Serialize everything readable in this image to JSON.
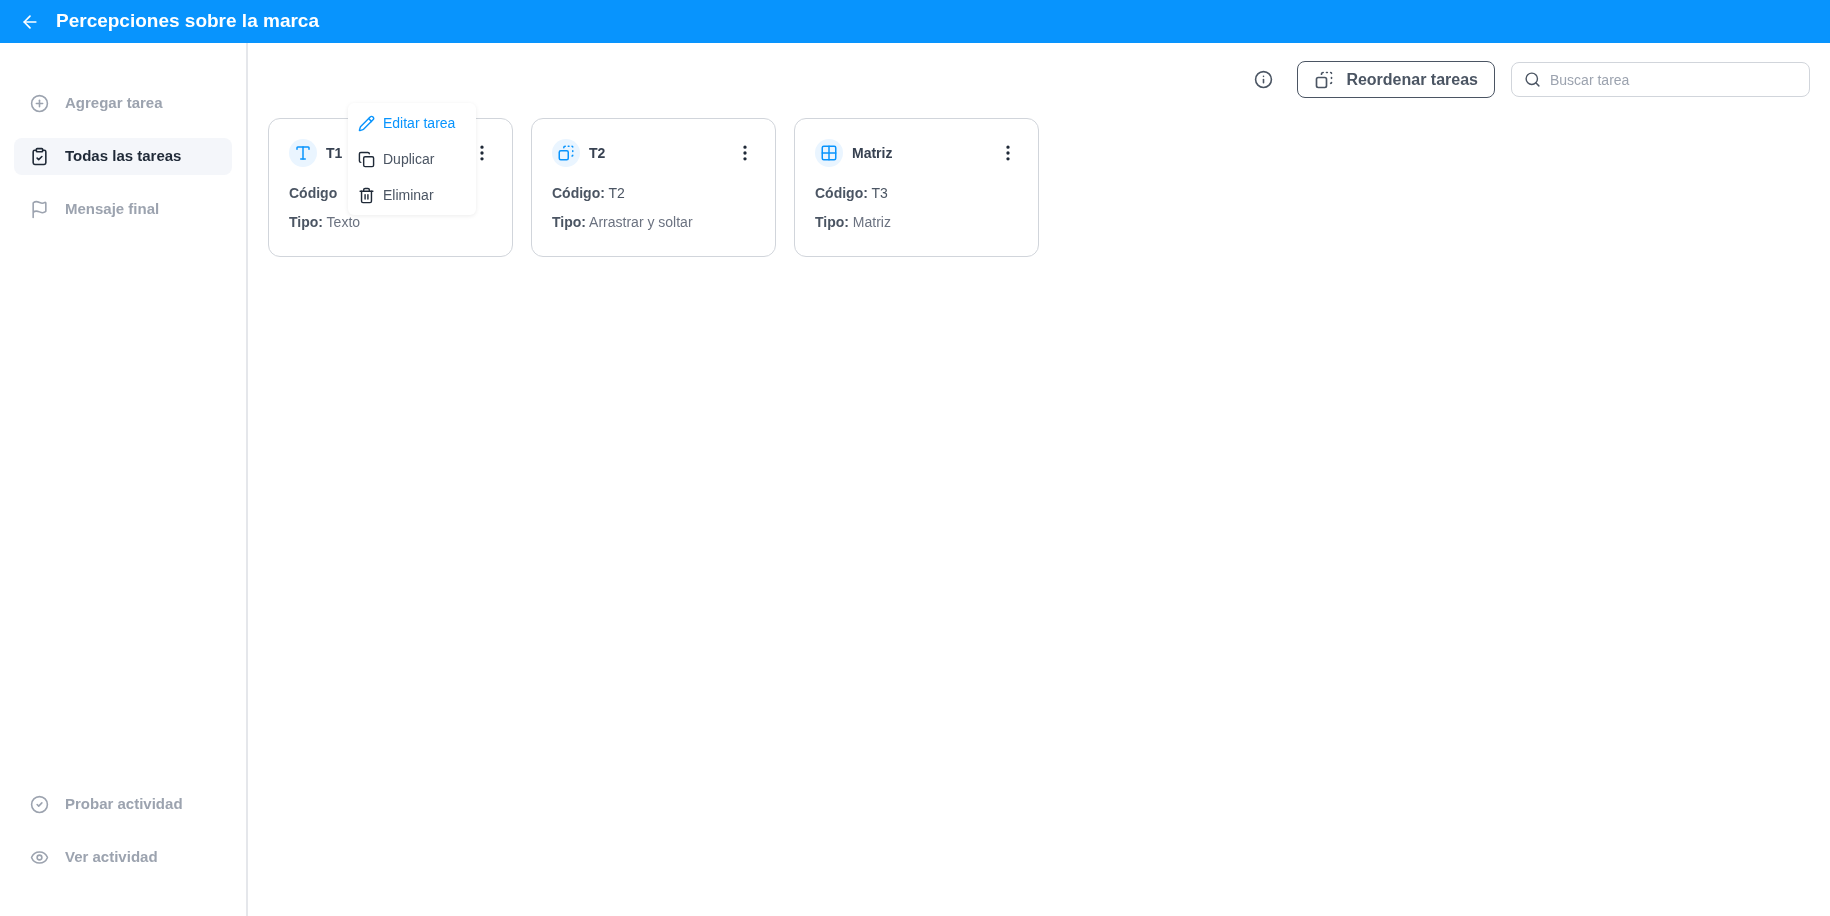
{
  "header": {
    "title": "Percepciones sobre la marca"
  },
  "sidebar": {
    "items": [
      {
        "kind": "add",
        "label": "Agregar tarea",
        "selected": false
      },
      {
        "kind": "tasks",
        "label": "Todas las tareas",
        "selected": true
      },
      {
        "kind": "flag",
        "label": "Mensaje final",
        "selected": false
      }
    ],
    "bottom_items": [
      {
        "kind": "check",
        "label": "Probar actividad"
      },
      {
        "kind": "eye",
        "label": "Ver actividad"
      }
    ]
  },
  "toolbar": {
    "reorder_button": "Reordenar tareas",
    "search": {
      "placeholder": "Buscar tarea"
    }
  },
  "cards": [
    {
      "kind": "text",
      "title": "T1",
      "code_label": "Código",
      "type_label": "Tipo:",
      "type": "Texto"
    },
    {
      "kind": "drag",
      "title": "T2",
      "code_label": "Código:",
      "code": "T2",
      "type_label": "Tipo:",
      "type": "Arrastrar y soltar"
    },
    {
      "kind": "matrix",
      "title": "Matriz",
      "code_label": "Código:",
      "code": "T3",
      "type_label": "Tipo:",
      "type": "Matriz"
    }
  ],
  "card_menu": {
    "items": [
      {
        "kind": "edit",
        "label": "Editar tarea",
        "selected": true
      },
      {
        "kind": "duplicate",
        "label": "Duplicar",
        "selected": false
      },
      {
        "kind": "delete",
        "label": "Eliminar",
        "selected": false
      }
    ]
  }
}
